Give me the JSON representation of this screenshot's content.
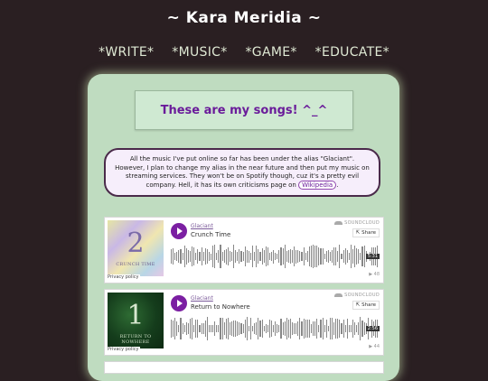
{
  "site": {
    "title": "~ Kara Meridia ~"
  },
  "nav": [
    {
      "label": "*WRITE*"
    },
    {
      "label": "*MUSIC*"
    },
    {
      "label": "*GAME*"
    },
    {
      "label": "*EDUCATE*"
    }
  ],
  "main": {
    "heading": "These are my songs! ^_^",
    "intro_text": "All the music I've put online so far has been under the alias \"Glaciant\". However, I plan to change my alias in the near future and then put my music on streaming services. They won't be on Spotify though, cuz it's a pretty evil company. Hell, it has its own criticisms page on",
    "intro_link": "Wikipedia",
    "intro_end": "."
  },
  "players": [
    {
      "artist": "Glaciant",
      "track": "Crunch Time",
      "art_number": "2",
      "art_caption": "CRUNCH TIME",
      "duration": "5:31",
      "plays": "▶ 48",
      "share": "Share",
      "brand": "SOUNDCLOUD",
      "privacy": "Privacy policy"
    },
    {
      "artist": "Glaciant",
      "track": "Return to Nowhere",
      "art_number": "1",
      "art_caption": "RETURN TO NOWHERE",
      "duration": "2:56",
      "plays": "▶ 44",
      "share": "Share",
      "brand": "SOUNDCLOUD",
      "privacy": "Privacy policy"
    }
  ],
  "colors": {
    "background": "#2a1f22",
    "panel": "#bfdcc0",
    "accent_purple": "#6a1b9a",
    "play_button": "#7b1fa2"
  }
}
